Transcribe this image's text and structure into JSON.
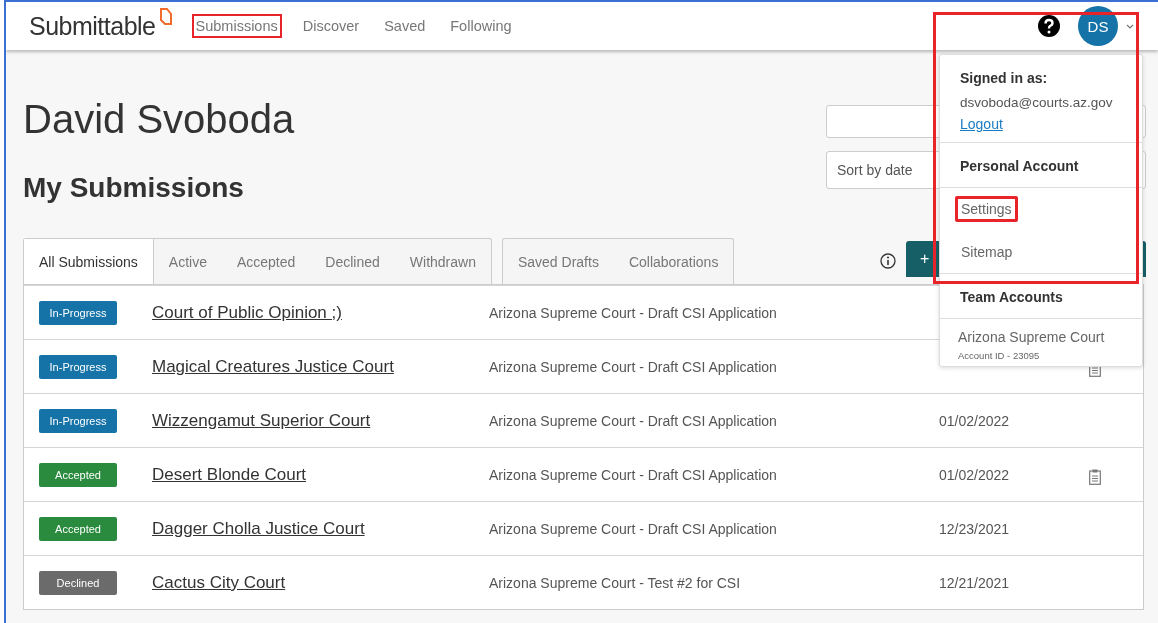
{
  "header": {
    "logo": "Submittable",
    "nav": [
      {
        "label": "Submissions",
        "highlighted": true
      },
      {
        "label": "Discover",
        "highlighted": false
      },
      {
        "label": "Saved",
        "highlighted": false
      },
      {
        "label": "Following",
        "highlighted": false
      }
    ],
    "avatar": "DS"
  },
  "page_title": "David Svoboda",
  "section_title": "My Submissions",
  "sort": {
    "value": "Sort by date"
  },
  "new_button": "+",
  "tab_groups": [
    [
      {
        "label": "All Submissions",
        "selected": true
      },
      {
        "label": "Active",
        "selected": false
      },
      {
        "label": "Accepted",
        "selected": false
      },
      {
        "label": "Declined",
        "selected": false
      },
      {
        "label": "Withdrawn",
        "selected": false
      }
    ],
    [
      {
        "label": "Saved Drafts",
        "selected": false
      },
      {
        "label": "Collaborations",
        "selected": false
      }
    ]
  ],
  "rows": [
    {
      "status": "In-Progress",
      "kind": "in_progress",
      "title": "Court of Public Opinion ;)",
      "form": "Arizona Supreme Court - Draft CSI Application",
      "has_note": false
    },
    {
      "status": "In-Progress",
      "kind": "in_progress",
      "title": "Magical Creatures Justice Court",
      "form": "Arizona Supreme Court - Draft CSI Application",
      "has_note": true
    },
    {
      "status": "In-Progress",
      "kind": "in_progress",
      "title": "Wizzengamut Superior Court",
      "form": "Arizona Supreme Court - Draft CSI Application",
      "date": "01/02/2022",
      "has_note": false
    },
    {
      "status": "Accepted",
      "kind": "accepted",
      "title": "Desert Blonde Court",
      "form": "Arizona Supreme Court - Draft CSI Application",
      "date": "01/02/2022",
      "has_note": true
    },
    {
      "status": "Accepted",
      "kind": "accepted",
      "title": "Dagger Cholla Justice Court",
      "form": "Arizona Supreme Court - Draft CSI Application",
      "date": "12/23/2021",
      "has_note": false
    },
    {
      "status": "Declined",
      "kind": "declined",
      "title": "Cactus City Court",
      "form": "Arizona Supreme Court - Test #2 for CSI",
      "date": "12/21/2021",
      "has_note": false
    }
  ],
  "account_menu": {
    "signed_in_label": "Signed in as:",
    "email": "dsvoboda@courts.az.gov",
    "logout": "Logout",
    "personal_heading": "Personal Account",
    "personal_items": [
      {
        "label": "Settings",
        "highlighted": true
      },
      {
        "label": "Sitemap",
        "highlighted": false
      }
    ],
    "team_heading": "Team Accounts",
    "teams": [
      {
        "name": "Arizona Supreme Court",
        "account_id": "Account ID - 23095"
      }
    ]
  }
}
